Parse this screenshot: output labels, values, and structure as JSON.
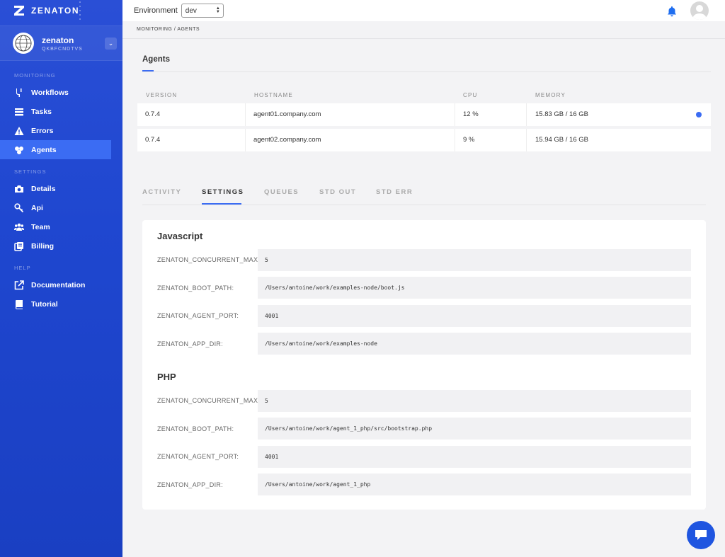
{
  "brand": {
    "name": "ZENATON"
  },
  "account": {
    "name": "zenaton",
    "id": "QKBFCNDTVS"
  },
  "nav": {
    "monitoring_label": "MONITORING",
    "monitoring": [
      "Workflows",
      "Tasks",
      "Errors",
      "Agents"
    ],
    "settings_label": "SETTINGS",
    "settings": [
      "Details",
      "Api",
      "Team",
      "Billing"
    ],
    "help_label": "HELP",
    "help": [
      "Documentation",
      "Tutorial"
    ],
    "active": "Agents"
  },
  "topbar": {
    "env_label": "Environment",
    "env_value": "dev"
  },
  "breadcrumb": "MONITORING  /  AGENTS",
  "page": {
    "title": "Agents"
  },
  "table": {
    "headers": [
      "VERSION",
      "HOSTNAME",
      "CPU",
      "MEMORY"
    ],
    "rows": [
      {
        "version": "0.7.4",
        "hostname": "agent01.company.com",
        "cpu": "12 %",
        "memory": "15.83 GB / 16 GB",
        "selected": true
      },
      {
        "version": "0.7.4",
        "hostname": "agent02.company.com",
        "cpu": "9 %",
        "memory": "15.94 GB / 16 GB",
        "selected": false
      }
    ]
  },
  "tabs": [
    "ACTIVITY",
    "SETTINGS",
    "QUEUES",
    "STD OUT",
    "STD ERR"
  ],
  "active_tab": "SETTINGS",
  "settings": {
    "javascript": {
      "title": "Javascript",
      "items": [
        {
          "key": "ZENATON_CONCURRENT_MAX:",
          "value": "5"
        },
        {
          "key": "ZENATON_BOOT_PATH:",
          "value": "/Users/antoine/work/examples-node/boot.js"
        },
        {
          "key": "ZENATON_AGENT_PORT:",
          "value": "4001"
        },
        {
          "key": "ZENATON_APP_DIR:",
          "value": "/Users/antoine/work/examples-node"
        }
      ]
    },
    "php": {
      "title": "PHP",
      "items": [
        {
          "key": "ZENATON_CONCURRENT_MAX:",
          "value": "5"
        },
        {
          "key": "ZENATON_BOOT_PATH:",
          "value": "/Users/antoine/work/agent_1_php/src/bootstrap.php"
        },
        {
          "key": "ZENATON_AGENT_PORT:",
          "value": "4001"
        },
        {
          "key": "ZENATON_APP_DIR:",
          "value": "/Users/antoine/work/agent_1_php"
        }
      ]
    }
  },
  "colors": {
    "accent": "#3b6cf3",
    "sidebar": "#1f47d0"
  }
}
